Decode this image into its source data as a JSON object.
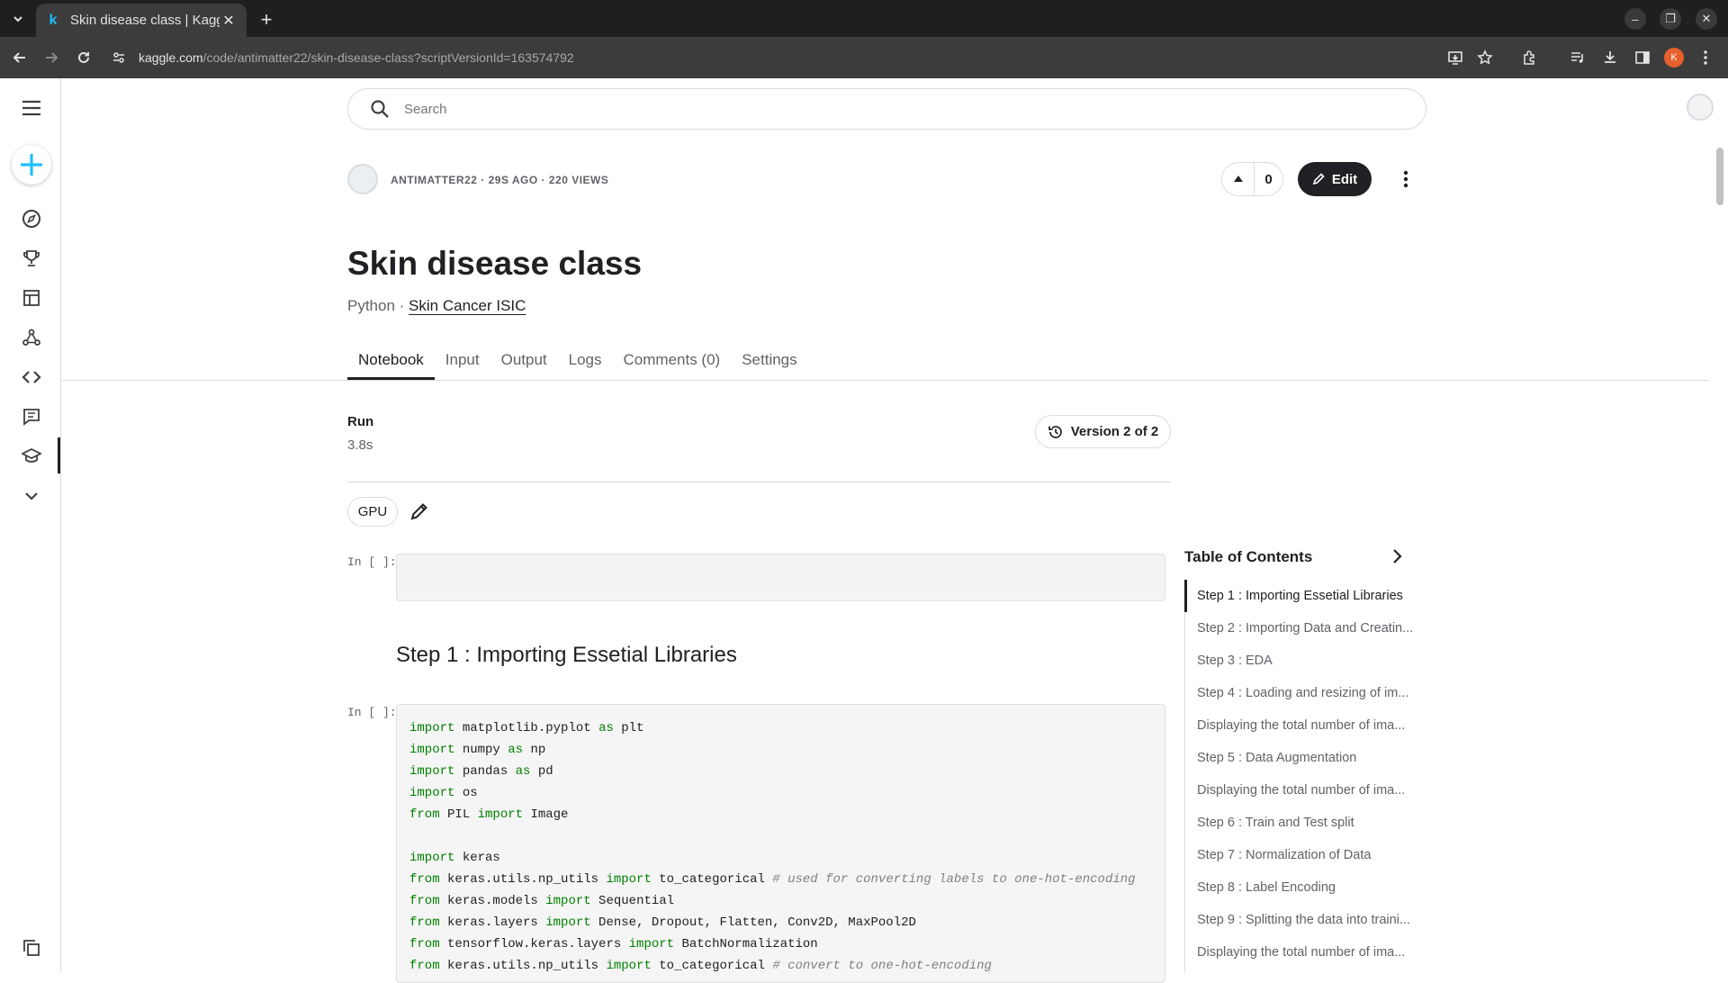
{
  "browser": {
    "tab_title": "Skin disease class | Kagg",
    "url_host": "kaggle.com",
    "url_path": "/code/antimatter22/skin-disease-class?scriptVersionId=163574792",
    "profile_initial": "K"
  },
  "search": {
    "placeholder": "Search"
  },
  "author": {
    "meta": "ANTIMATTER22 · 29S AGO · 220 VIEWS"
  },
  "vote": {
    "count": "0"
  },
  "actions": {
    "edit_label": "Edit"
  },
  "notebook": {
    "title": "Skin disease class",
    "language": "Python",
    "separator": " · ",
    "dataset": "Skin Cancer ISIC"
  },
  "tabs": [
    "Notebook",
    "Input",
    "Output",
    "Logs",
    "Comments (0)",
    "Settings"
  ],
  "run": {
    "label": "Run",
    "value": "3.8s"
  },
  "version": {
    "label": "Version 2 of 2"
  },
  "accelerator": {
    "label": "GPU"
  },
  "cells": {
    "prompt_1": "In [ ]:",
    "prompt_2": "In [ ]:",
    "heading": "Step 1 : Importing Essetial Libraries"
  },
  "code": [
    [
      [
        "kw",
        "import"
      ],
      [
        "t",
        " matplotlib.pyplot "
      ],
      [
        "kw",
        "as"
      ],
      [
        "t",
        " plt"
      ]
    ],
    [
      [
        "kw",
        "import"
      ],
      [
        "t",
        " numpy "
      ],
      [
        "kw",
        "as"
      ],
      [
        "t",
        " np"
      ]
    ],
    [
      [
        "kw",
        "import"
      ],
      [
        "t",
        " pandas "
      ],
      [
        "kw",
        "as"
      ],
      [
        "t",
        " pd"
      ]
    ],
    [
      [
        "kw",
        "import"
      ],
      [
        "t",
        " os"
      ]
    ],
    [
      [
        "kw",
        "from"
      ],
      [
        "t",
        " PIL "
      ],
      [
        "kw",
        "import"
      ],
      [
        "t",
        " Image"
      ]
    ],
    [],
    [
      [
        "kw",
        "import"
      ],
      [
        "t",
        " keras"
      ]
    ],
    [
      [
        "kw",
        "from"
      ],
      [
        "t",
        " keras.utils.np_utils "
      ],
      [
        "kw",
        "import"
      ],
      [
        "t",
        " to_categorical "
      ],
      [
        "cm",
        "# used for converting labels to one-hot-encoding"
      ]
    ],
    [
      [
        "kw",
        "from"
      ],
      [
        "t",
        " keras.models "
      ],
      [
        "kw",
        "import"
      ],
      [
        "t",
        " Sequential"
      ]
    ],
    [
      [
        "kw",
        "from"
      ],
      [
        "t",
        " keras.layers "
      ],
      [
        "kw",
        "import"
      ],
      [
        "t",
        " Dense, Dropout, Flatten, Conv2D, MaxPool2D"
      ]
    ],
    [
      [
        "kw",
        "from"
      ],
      [
        "t",
        " tensorflow.keras.layers "
      ],
      [
        "kw",
        "import"
      ],
      [
        "t",
        " BatchNormalization"
      ]
    ],
    [
      [
        "kw",
        "from"
      ],
      [
        "t",
        " keras.utils.np_utils "
      ],
      [
        "kw",
        "import"
      ],
      [
        "t",
        " to_categorical "
      ],
      [
        "cm",
        "# convert to one-hot-encoding"
      ]
    ]
  ],
  "toc": {
    "title": "Table of Contents",
    "items": [
      "Step 1 : Importing Essetial Libraries",
      "Step 2 : Importing Data and Creatin...",
      "Step 3 : EDA",
      "Step 4 : Loading and resizing of im...",
      "Displaying the total number of ima...",
      "Step 5 : Data Augmentation",
      "Displaying the total number of ima...",
      "Step 6 : Train and Test split",
      "Step 7 : Normalization of Data",
      "Step 8 : Label Encoding",
      "Step 9 : Splitting the data into traini...",
      "Displaying the total number of ima..."
    ]
  },
  "colors": {
    "kaggle_blue": "#20beff",
    "code_keyword": "#008000",
    "code_comment": "#808080"
  }
}
